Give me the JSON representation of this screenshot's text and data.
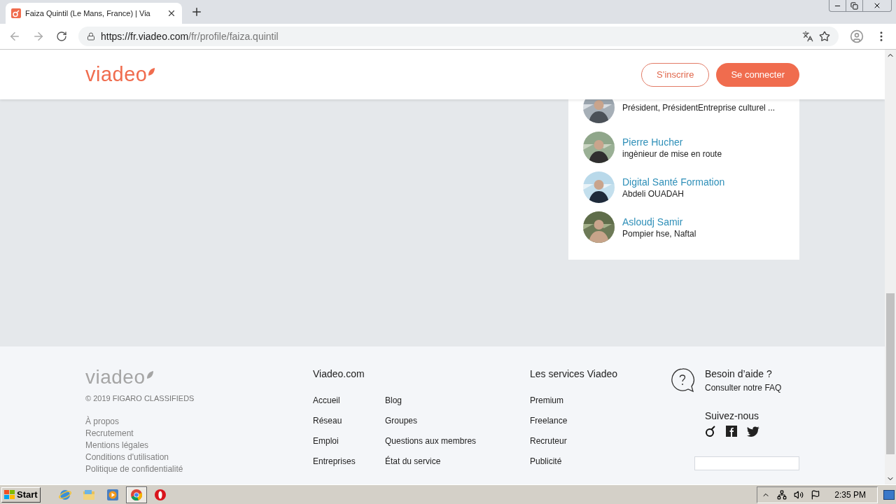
{
  "browser": {
    "tab": {
      "title": "Faiza Quintil (Le Mans, France) | Via"
    },
    "url": {
      "host": "https://fr.viadeo.com",
      "path": "/fr/profile/faiza.quintil"
    }
  },
  "header": {
    "logo": "viadeo",
    "signup": "S’inscrire",
    "login": "Se connecter"
  },
  "people": [
    {
      "subtitle": "Président, PrésidentEntreprise culturel ..."
    },
    {
      "name": "Pierre Hucher",
      "subtitle": "ingènieur de mise en route"
    },
    {
      "name": "Digital Santé Formation",
      "subtitle": "Abdeli OUADAH"
    },
    {
      "name": "Asloudj Samir",
      "subtitle": "Pompier hse, Naftal"
    }
  ],
  "footer": {
    "logo": "viadeo",
    "copyright": "© 2019 FIGARO CLASSIFIEDS",
    "legal_links": [
      "À propos",
      "Recrutement",
      "Mentions légales",
      "Conditions d'utilisation",
      "Politique de confidentialité"
    ],
    "site": {
      "title": "Viadeo.com",
      "column_1": [
        "Accueil",
        "Réseau",
        "Emploi",
        "Entreprises"
      ],
      "column_2": [
        "Blog",
        "Groupes",
        "Questions aux membres",
        "État du service"
      ]
    },
    "services": {
      "title": "Les services Viadeo",
      "links": [
        "Premium",
        "Freelance",
        "Recruteur",
        "Publicité"
      ]
    },
    "help": {
      "title": "Besoin d’aide ?",
      "link": "Consulter notre FAQ"
    },
    "follow": {
      "title": "Suivez-nous",
      "networks": [
        {
          "kind": "viadeo"
        },
        {
          "kind": "facebook"
        },
        {
          "kind": "twitter"
        }
      ]
    }
  },
  "taskbar": {
    "start": "Start",
    "apps": [
      {
        "kind": "ie",
        "selected": false
      },
      {
        "kind": "explorer",
        "selected": false
      },
      {
        "kind": "media",
        "selected": false
      },
      {
        "kind": "chrome",
        "selected": true
      },
      {
        "kind": "opera",
        "selected": false
      }
    ],
    "time": "2:35 PM"
  }
}
